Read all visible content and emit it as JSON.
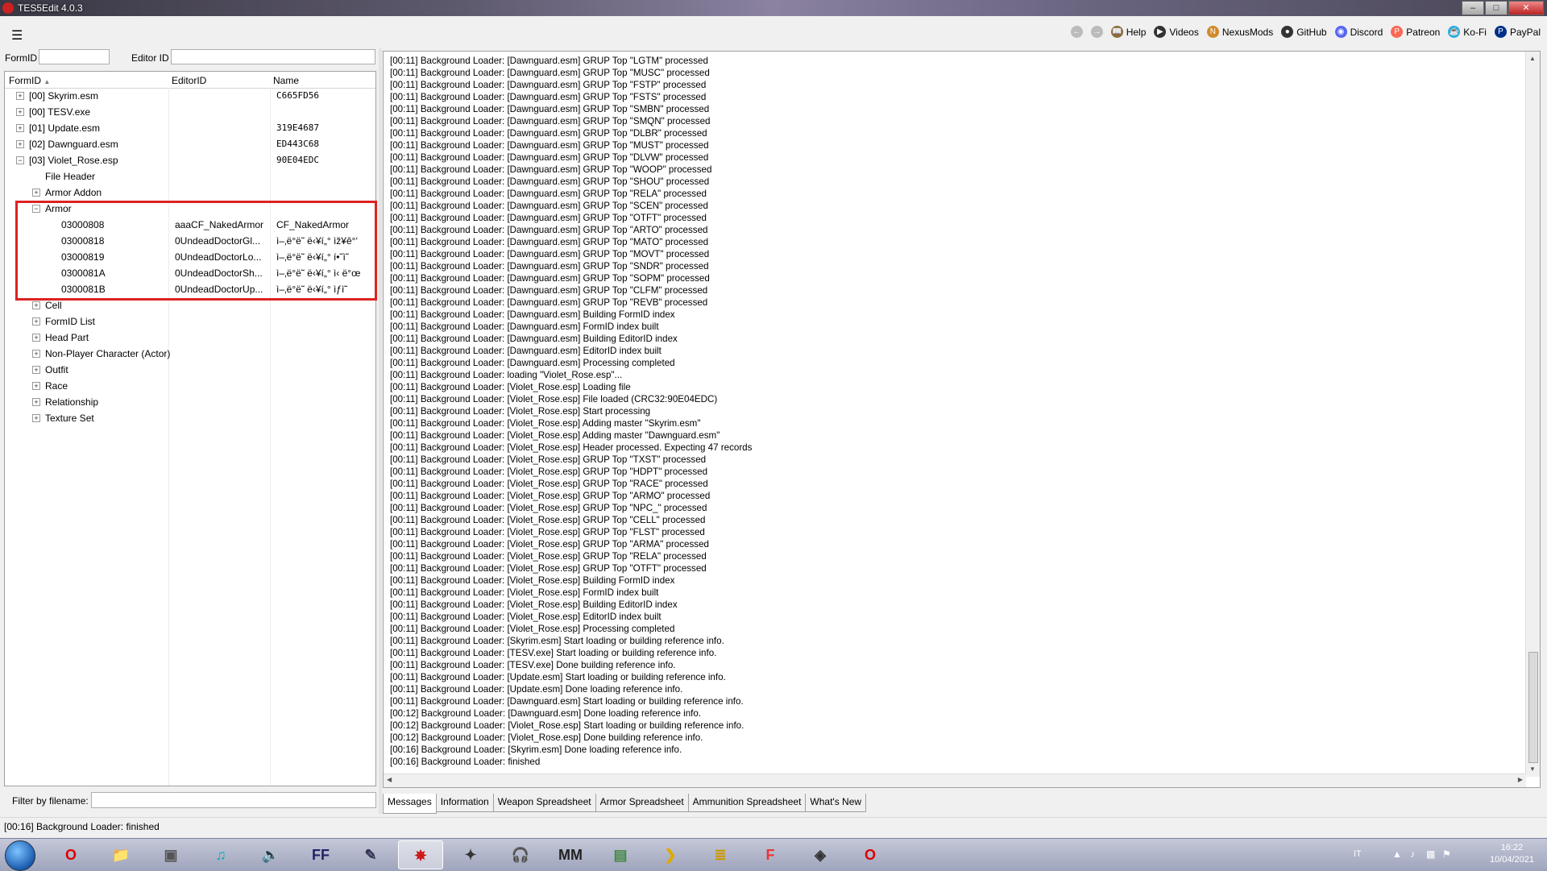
{
  "window": {
    "title": "TES5Edit 4.0.3"
  },
  "toolbar": {
    "menu_icon": "hamburger-icon",
    "links": [
      {
        "label": "Help",
        "icon": "book-icon"
      },
      {
        "label": "Videos",
        "icon": "video-icon"
      },
      {
        "label": "NexusMods",
        "icon": "nexus-icon"
      },
      {
        "label": "GitHub",
        "icon": "github-icon"
      },
      {
        "label": "Discord",
        "icon": "discord-icon"
      },
      {
        "label": "Patreon",
        "icon": "patreon-icon"
      },
      {
        "label": "Ko-Fi",
        "icon": "kofi-icon"
      },
      {
        "label": "PayPal",
        "icon": "paypal-icon"
      }
    ]
  },
  "filter": {
    "formid_label": "FormID",
    "formid_value": "",
    "editorid_label": "Editor ID",
    "editorid_value": ""
  },
  "tree": {
    "columns": [
      "FormID",
      "EditorID",
      "Name"
    ],
    "rows": [
      {
        "label": "[00] Skyrim.esm",
        "editorid": "",
        "name": "C665FD56",
        "level": 0,
        "state": "collapsed"
      },
      {
        "label": "[00] TESV.exe",
        "editorid": "",
        "name": "",
        "level": 0,
        "state": "collapsed"
      },
      {
        "label": "[01] Update.esm",
        "editorid": "",
        "name": "319E4687",
        "level": 0,
        "state": "collapsed"
      },
      {
        "label": "[02] Dawnguard.esm",
        "editorid": "",
        "name": "ED443C68",
        "level": 0,
        "state": "collapsed"
      },
      {
        "label": "[03] Violet_Rose.esp",
        "editorid": "",
        "name": "90E04EDC",
        "level": 0,
        "state": "expanded"
      },
      {
        "label": "File Header",
        "editorid": "",
        "name": "",
        "level": 1,
        "state": "leaf"
      },
      {
        "label": "Armor Addon",
        "editorid": "",
        "name": "",
        "level": 1,
        "state": "collapsed"
      },
      {
        "label": "Armor",
        "editorid": "",
        "name": "",
        "level": 1,
        "state": "expanded"
      },
      {
        "label": "03000808",
        "editorid": "aaaCF_NakedArmor",
        "name": "CF_NakedArmor",
        "level": 2,
        "state": "leaf"
      },
      {
        "label": "03000818",
        "editorid": "0UndeadDoctorGl...",
        "name": "ì–‚ë°ë˜ ë‹¥í„° ìž¥ê°‘",
        "level": 2,
        "state": "leaf"
      },
      {
        "label": "03000819",
        "editorid": "0UndeadDoctorLo...",
        "name": "ì–‚ë°ë˜ ë‹¥í„° í•˜ì˜",
        "level": 2,
        "state": "leaf"
      },
      {
        "label": "0300081A",
        "editorid": "0UndeadDoctorSh...",
        "name": "ì–‚ë°ë˜ ë‹¥í„° ì‹ ë°œ",
        "level": 2,
        "state": "leaf"
      },
      {
        "label": "0300081B",
        "editorid": "0UndeadDoctorUp...",
        "name": "ì–‚ë°ë˜ ë‹¥í„° ìƒì˜",
        "level": 2,
        "state": "leaf"
      },
      {
        "label": "Cell",
        "editorid": "",
        "name": "",
        "level": 1,
        "state": "collapsed"
      },
      {
        "label": "FormID List",
        "editorid": "",
        "name": "",
        "level": 1,
        "state": "collapsed"
      },
      {
        "label": "Head Part",
        "editorid": "",
        "name": "",
        "level": 1,
        "state": "collapsed"
      },
      {
        "label": "Non-Player Character (Actor)",
        "editorid": "",
        "name": "",
        "level": 1,
        "state": "collapsed"
      },
      {
        "label": "Outfit",
        "editorid": "",
        "name": "",
        "level": 1,
        "state": "collapsed"
      },
      {
        "label": "Race",
        "editorid": "",
        "name": "",
        "level": 1,
        "state": "collapsed"
      },
      {
        "label": "Relationship",
        "editorid": "",
        "name": "",
        "level": 1,
        "state": "collapsed"
      },
      {
        "label": "Texture Set",
        "editorid": "",
        "name": "",
        "level": 1,
        "state": "collapsed"
      }
    ]
  },
  "file_filter": {
    "label": "Filter by filename:",
    "value": ""
  },
  "messages": [
    "[00:11] Background Loader: [Dawnguard.esm] GRUP Top \"LGTM\" processed",
    "[00:11] Background Loader: [Dawnguard.esm] GRUP Top \"MUSC\" processed",
    "[00:11] Background Loader: [Dawnguard.esm] GRUP Top \"FSTP\" processed",
    "[00:11] Background Loader: [Dawnguard.esm] GRUP Top \"FSTS\" processed",
    "[00:11] Background Loader: [Dawnguard.esm] GRUP Top \"SMBN\" processed",
    "[00:11] Background Loader: [Dawnguard.esm] GRUP Top \"SMQN\" processed",
    "[00:11] Background Loader: [Dawnguard.esm] GRUP Top \"DLBR\" processed",
    "[00:11] Background Loader: [Dawnguard.esm] GRUP Top \"MUST\" processed",
    "[00:11] Background Loader: [Dawnguard.esm] GRUP Top \"DLVW\" processed",
    "[00:11] Background Loader: [Dawnguard.esm] GRUP Top \"WOOP\" processed",
    "[00:11] Background Loader: [Dawnguard.esm] GRUP Top \"SHOU\" processed",
    "[00:11] Background Loader: [Dawnguard.esm] GRUP Top \"RELA\" processed",
    "[00:11] Background Loader: [Dawnguard.esm] GRUP Top \"SCEN\" processed",
    "[00:11] Background Loader: [Dawnguard.esm] GRUP Top \"OTFT\" processed",
    "[00:11] Background Loader: [Dawnguard.esm] GRUP Top \"ARTO\" processed",
    "[00:11] Background Loader: [Dawnguard.esm] GRUP Top \"MATO\" processed",
    "[00:11] Background Loader: [Dawnguard.esm] GRUP Top \"MOVT\" processed",
    "[00:11] Background Loader: [Dawnguard.esm] GRUP Top \"SNDR\" processed",
    "[00:11] Background Loader: [Dawnguard.esm] GRUP Top \"SOPM\" processed",
    "[00:11] Background Loader: [Dawnguard.esm] GRUP Top \"CLFM\" processed",
    "[00:11] Background Loader: [Dawnguard.esm] GRUP Top \"REVB\" processed",
    "[00:11] Background Loader: [Dawnguard.esm] Building FormID index",
    "[00:11] Background Loader: [Dawnguard.esm] FormID index built",
    "[00:11] Background Loader: [Dawnguard.esm] Building EditorID index",
    "[00:11] Background Loader: [Dawnguard.esm] EditorID index built",
    "[00:11] Background Loader: [Dawnguard.esm] Processing completed",
    "[00:11] Background Loader: loading \"Violet_Rose.esp\"...",
    "[00:11] Background Loader: [Violet_Rose.esp] Loading file",
    "[00:11] Background Loader: [Violet_Rose.esp] File loaded (CRC32:90E04EDC)",
    "[00:11] Background Loader: [Violet_Rose.esp] Start processing",
    "[00:11] Background Loader: [Violet_Rose.esp] Adding master \"Skyrim.esm\"",
    "[00:11] Background Loader: [Violet_Rose.esp] Adding master \"Dawnguard.esm\"",
    "[00:11] Background Loader: [Violet_Rose.esp] Header processed. Expecting 47 records",
    "[00:11] Background Loader: [Violet_Rose.esp] GRUP Top \"TXST\" processed",
    "[00:11] Background Loader: [Violet_Rose.esp] GRUP Top \"HDPT\" processed",
    "[00:11] Background Loader: [Violet_Rose.esp] GRUP Top \"RACE\" processed",
    "[00:11] Background Loader: [Violet_Rose.esp] GRUP Top \"ARMO\" processed",
    "[00:11] Background Loader: [Violet_Rose.esp] GRUP Top \"NPC_\" processed",
    "[00:11] Background Loader: [Violet_Rose.esp] GRUP Top \"CELL\" processed",
    "[00:11] Background Loader: [Violet_Rose.esp] GRUP Top \"FLST\" processed",
    "[00:11] Background Loader: [Violet_Rose.esp] GRUP Top \"ARMA\" processed",
    "[00:11] Background Loader: [Violet_Rose.esp] GRUP Top \"RELA\" processed",
    "[00:11] Background Loader: [Violet_Rose.esp] GRUP Top \"OTFT\" processed",
    "[00:11] Background Loader: [Violet_Rose.esp] Building FormID index",
    "[00:11] Background Loader: [Violet_Rose.esp] FormID index built",
    "[00:11] Background Loader: [Violet_Rose.esp] Building EditorID index",
    "[00:11] Background Loader: [Violet_Rose.esp] EditorID index built",
    "[00:11] Background Loader: [Violet_Rose.esp] Processing completed",
    "[00:11] Background Loader: [Skyrim.esm] Start loading or building reference info.",
    "[00:11] Background Loader: [TESV.exe] Start loading or building reference info.",
    "[00:11] Background Loader: [TESV.exe] Done building reference info.",
    "[00:11] Background Loader: [Update.esm] Start loading or building reference info.",
    "[00:11] Background Loader: [Update.esm] Done loading reference info.",
    "[00:11] Background Loader: [Dawnguard.esm] Start loading or building reference info.",
    "[00:12] Background Loader: [Dawnguard.esm] Done loading reference info.",
    "[00:12] Background Loader: [Violet_Rose.esp] Start loading or building reference info.",
    "[00:12] Background Loader: [Violet_Rose.esp] Done building reference info.",
    "[00:16] Background Loader: [Skyrim.esm] Done loading reference info.",
    "[00:16] Background Loader: finished"
  ],
  "tabs": [
    {
      "label": "Messages",
      "active": true
    },
    {
      "label": "Information",
      "active": false
    },
    {
      "label": "Weapon Spreadsheet",
      "active": false
    },
    {
      "label": "Armor Spreadsheet",
      "active": false
    },
    {
      "label": "Ammunition Spreadsheet",
      "active": false
    },
    {
      "label": "What's New",
      "active": false
    }
  ],
  "status": {
    "text": "[00:16] Background Loader: finished"
  },
  "taskbar": {
    "items": [
      "opera-icon",
      "explorer-icon",
      "media-icon",
      "music-icon",
      "volume-app-icon",
      "ffdec-icon",
      "pen-icon",
      "tes5edit-icon",
      "network-icon",
      "headphones-icon",
      "mod-manager-icon",
      "window-icon",
      "arrow-icon",
      "notes-icon",
      "flash-icon",
      "creation-icon",
      "opera-browser-icon"
    ],
    "tray_lang": "IT",
    "clock_time": "16:22",
    "clock_date": "10/04/2021"
  },
  "colors": {
    "highlight_box": "#dd2222",
    "accent": "#3a6ea5"
  }
}
